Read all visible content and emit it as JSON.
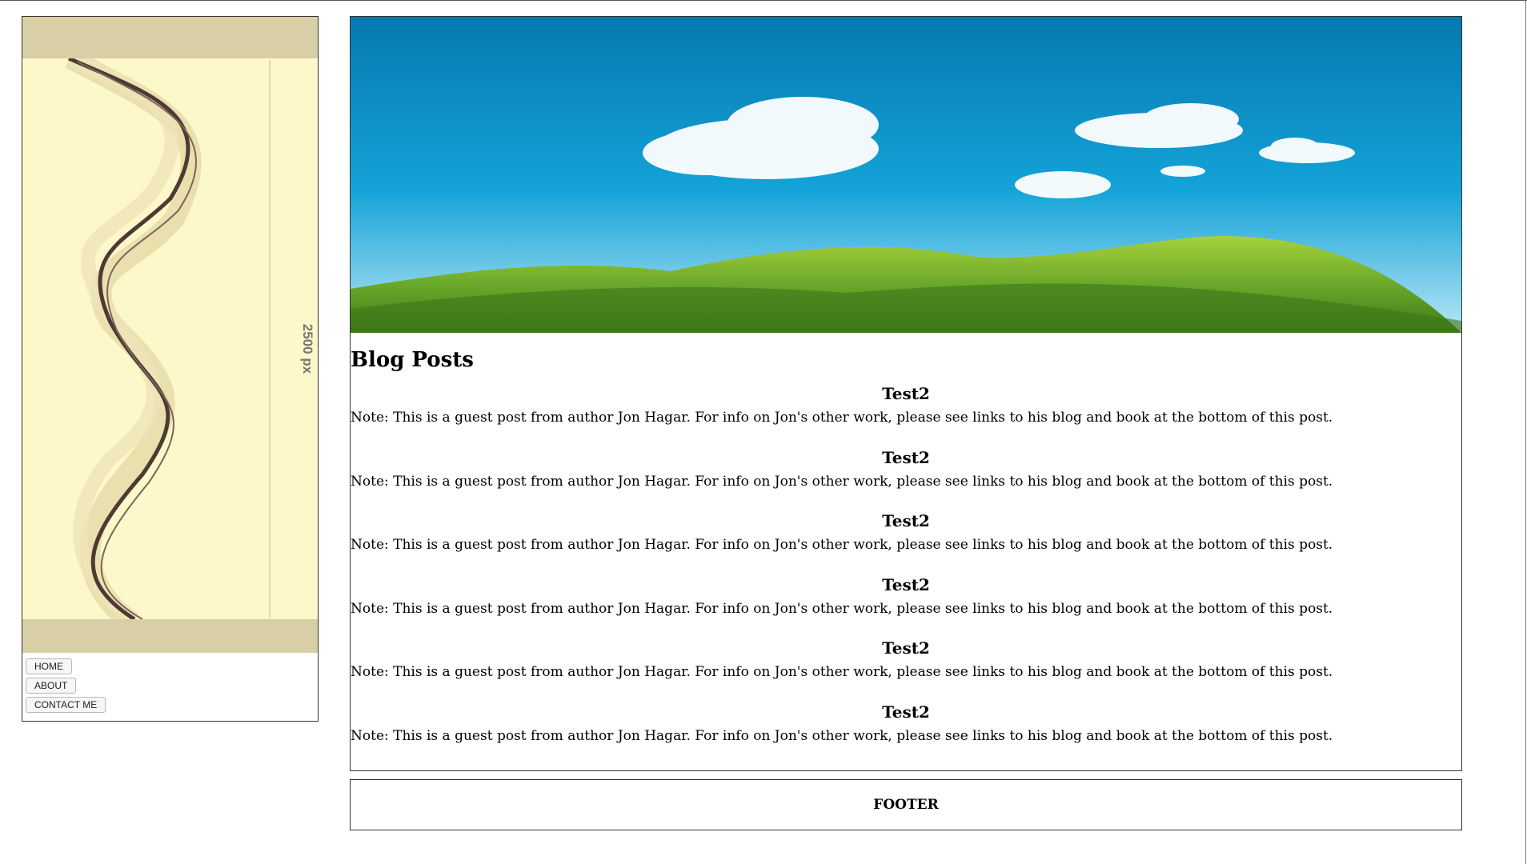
{
  "sidebar": {
    "banner_dimension_label": "2500 px",
    "nav": [
      {
        "label": "HOME"
      },
      {
        "label": "ABOUT"
      },
      {
        "label": "CONTACT ME"
      }
    ]
  },
  "main": {
    "section_title": "Blog Posts",
    "posts": [
      {
        "title": "Test2",
        "text": "Note: This is a guest post from author Jon Hagar. For info on Jon's other work, please see links to his blog and book at the bottom of this post."
      },
      {
        "title": "Test2",
        "text": "Note: This is a guest post from author Jon Hagar. For info on Jon's other work, please see links to his blog and book at the bottom of this post."
      },
      {
        "title": "Test2",
        "text": "Note: This is a guest post from author Jon Hagar. For info on Jon's other work, please see links to his blog and book at the bottom of this post."
      },
      {
        "title": "Test2",
        "text": "Note: This is a guest post from author Jon Hagar. For info on Jon's other work, please see links to his blog and book at the bottom of this post."
      },
      {
        "title": "Test2",
        "text": "Note: This is a guest post from author Jon Hagar. For info on Jon's other work, please see links to his blog and book at the bottom of this post."
      },
      {
        "title": "Test2",
        "text": "Note: This is a guest post from author Jon Hagar. For info on Jon's other work, please see links to his blog and book at the bottom of this post."
      }
    ]
  },
  "footer": {
    "label": "FOOTER"
  },
  "colors": {
    "banner_bg": "#fcf8c9",
    "banner_band": "#d8cfa6",
    "sky": "#0a88c4",
    "grass": "#5f9e22"
  }
}
